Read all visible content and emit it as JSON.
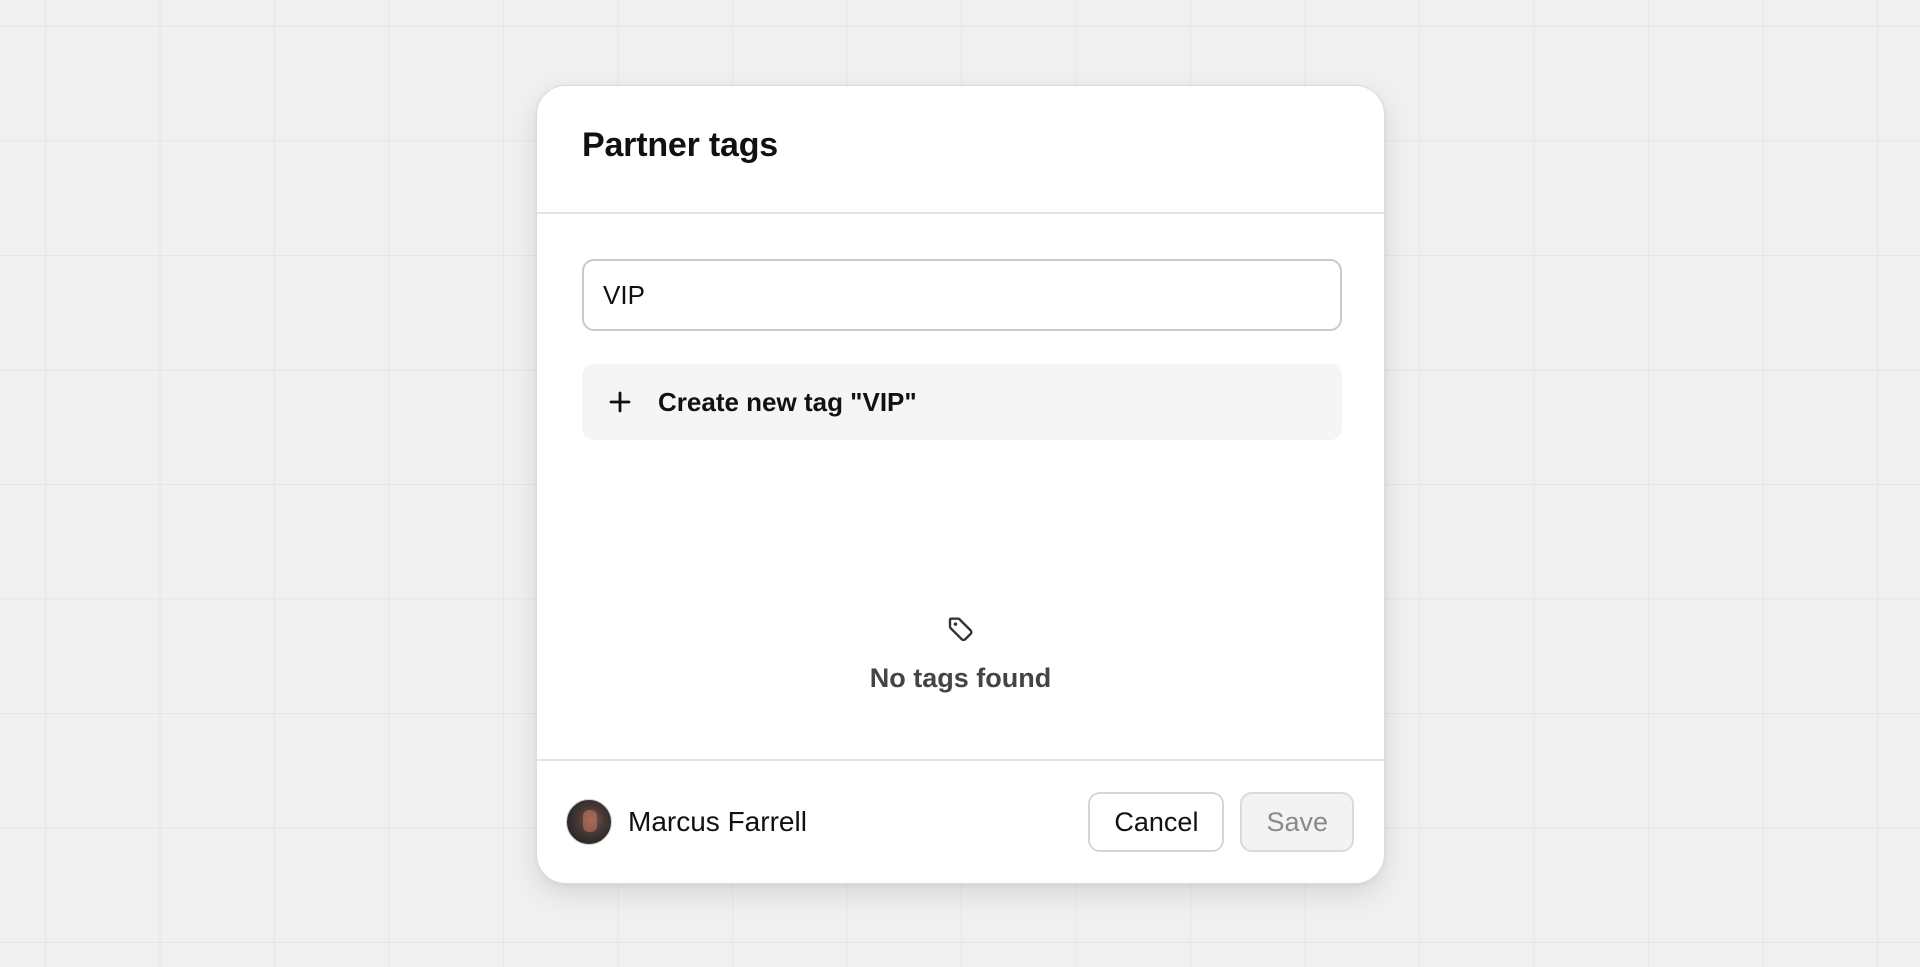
{
  "modal": {
    "title": "Partner tags"
  },
  "search": {
    "value": "VIP"
  },
  "create_option": {
    "label": "Create new tag \"VIP\"",
    "icon": "plus-icon"
  },
  "empty_state": {
    "icon": "tag-icon",
    "text": "No tags found"
  },
  "footer": {
    "user_name": "Marcus Farrell",
    "cancel_label": "Cancel",
    "save_label": "Save",
    "save_disabled": true
  },
  "colors": {
    "background": "#f0f0f0",
    "modal": "#ffffff",
    "option_bg": "#f5f5f5",
    "muted_text": "#8a8a8a"
  }
}
